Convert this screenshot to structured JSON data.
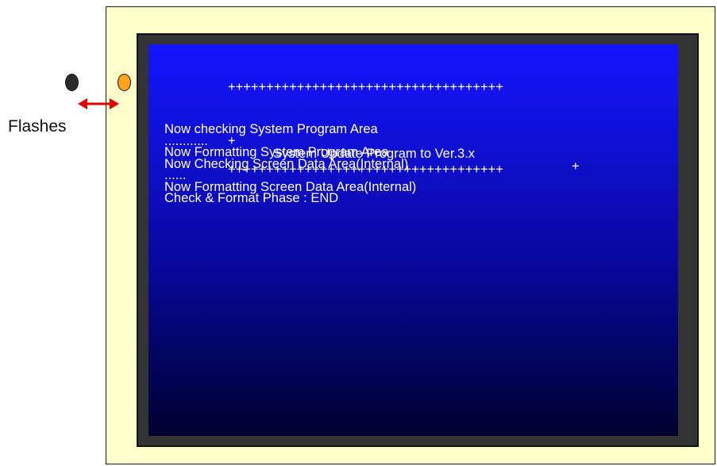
{
  "indicator": {
    "label": "Flashes",
    "led_off_color": "#2b2b2b",
    "led_on_color": "#ffa41c",
    "arrow_color": "#e00000"
  },
  "device": {
    "panel_color": "#ffffcc",
    "bezel_color": "#333333"
  },
  "screen": {
    "gradient_top": "#1414ff",
    "gradient_bottom": "#00002e",
    "banner": {
      "border": "++++++++++++++++++++++++++++++++++++",
      "plus": "+",
      "title": "System Update Program to Ver.3.x"
    },
    "log": [
      "Now checking System Program Area",
      "............",
      "Now Formatting System Program Area",
      "Now Checking Screen Data Area(Internal)",
      "......",
      "Now Formatting Screen Data Area(Internal)",
      "Check & Format Phase : END"
    ]
  }
}
